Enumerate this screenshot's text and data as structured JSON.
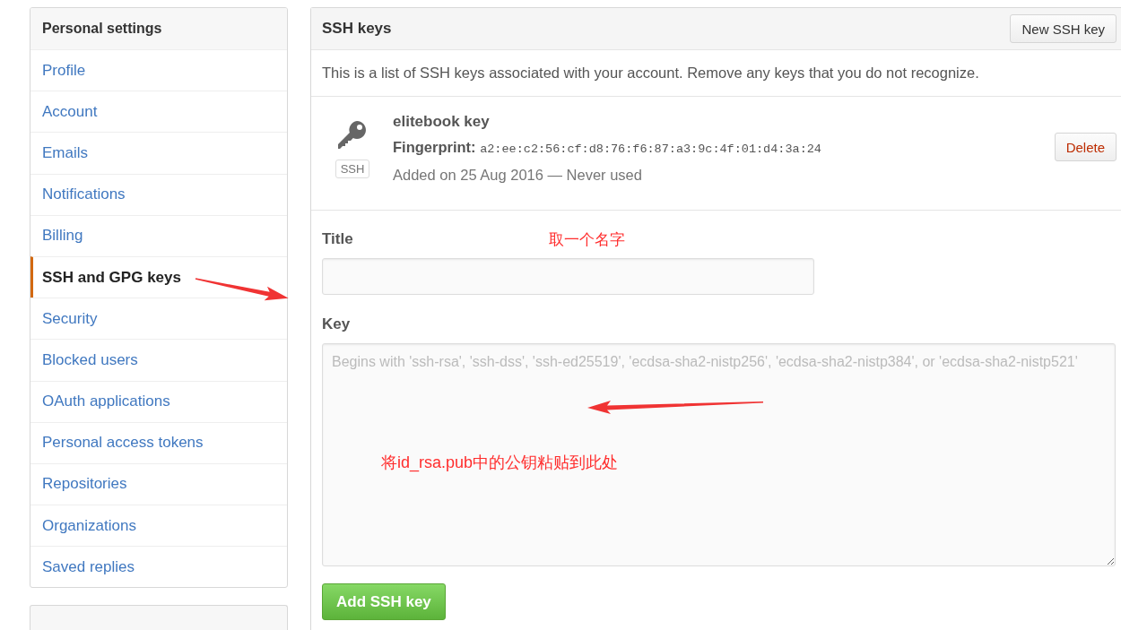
{
  "sidebar": {
    "title": "Personal settings",
    "items": [
      {
        "label": "Profile",
        "selected": false
      },
      {
        "label": "Account",
        "selected": false
      },
      {
        "label": "Emails",
        "selected": false
      },
      {
        "label": "Notifications",
        "selected": false
      },
      {
        "label": "Billing",
        "selected": false
      },
      {
        "label": "SSH and GPG keys",
        "selected": true
      },
      {
        "label": "Security",
        "selected": false
      },
      {
        "label": "Blocked users",
        "selected": false
      },
      {
        "label": "OAuth applications",
        "selected": false
      },
      {
        "label": "Personal access tokens",
        "selected": false
      },
      {
        "label": "Repositories",
        "selected": false
      },
      {
        "label": "Organizations",
        "selected": false
      },
      {
        "label": "Saved replies",
        "selected": false
      }
    ]
  },
  "main": {
    "title": "SSH keys",
    "new_button": "New SSH key",
    "description": "This is a list of SSH keys associated with your account. Remove any keys that you do not recognize.",
    "keys": [
      {
        "badge": "SSH",
        "title": "elitebook key",
        "fingerprint_label": "Fingerprint:",
        "fingerprint": "a2:ee:c2:56:cf:d8:76:f6:87:a3:9c:4f:01:d4:3a:24",
        "added": "Added on 25 Aug 2016 — Never used",
        "delete_button": "Delete"
      }
    ],
    "form": {
      "fields": [
        {
          "kind": "input",
          "label": "Title",
          "note": "取一个名字"
        },
        {
          "kind": "textarea",
          "label": "Key",
          "placeholder": "Begins with 'ssh-rsa', 'ssh-dss', 'ssh-ed25519', 'ecdsa-sha2-nistp256', 'ecdsa-sha2-nistp384', or 'ecdsa-sha2-nistp521'",
          "note": "将id_rsa.pub中的公钥粘贴到此处"
        }
      ],
      "submit": "Add SSH key"
    }
  }
}
